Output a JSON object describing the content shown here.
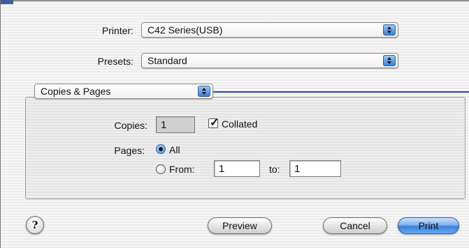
{
  "printer": {
    "label": "Printer:",
    "value": "C42 Series(USB)"
  },
  "presets": {
    "label": "Presets:",
    "value": "Standard"
  },
  "panel_menu": {
    "value": "Copies & Pages"
  },
  "copies": {
    "label": "Copies:",
    "value": "1",
    "collated_label": "Collated",
    "collated_checked": true
  },
  "pages": {
    "label": "Pages:",
    "all_label": "All",
    "from_label": "From:",
    "from_value": "1",
    "to_label": "to:",
    "to_value": "1",
    "selected": "all"
  },
  "buttons": {
    "help": "?",
    "preview": "Preview",
    "cancel": "Cancel",
    "print": "Print"
  },
  "colors": {
    "accent": "#3b80d8",
    "divider": "#2a4d8f"
  }
}
